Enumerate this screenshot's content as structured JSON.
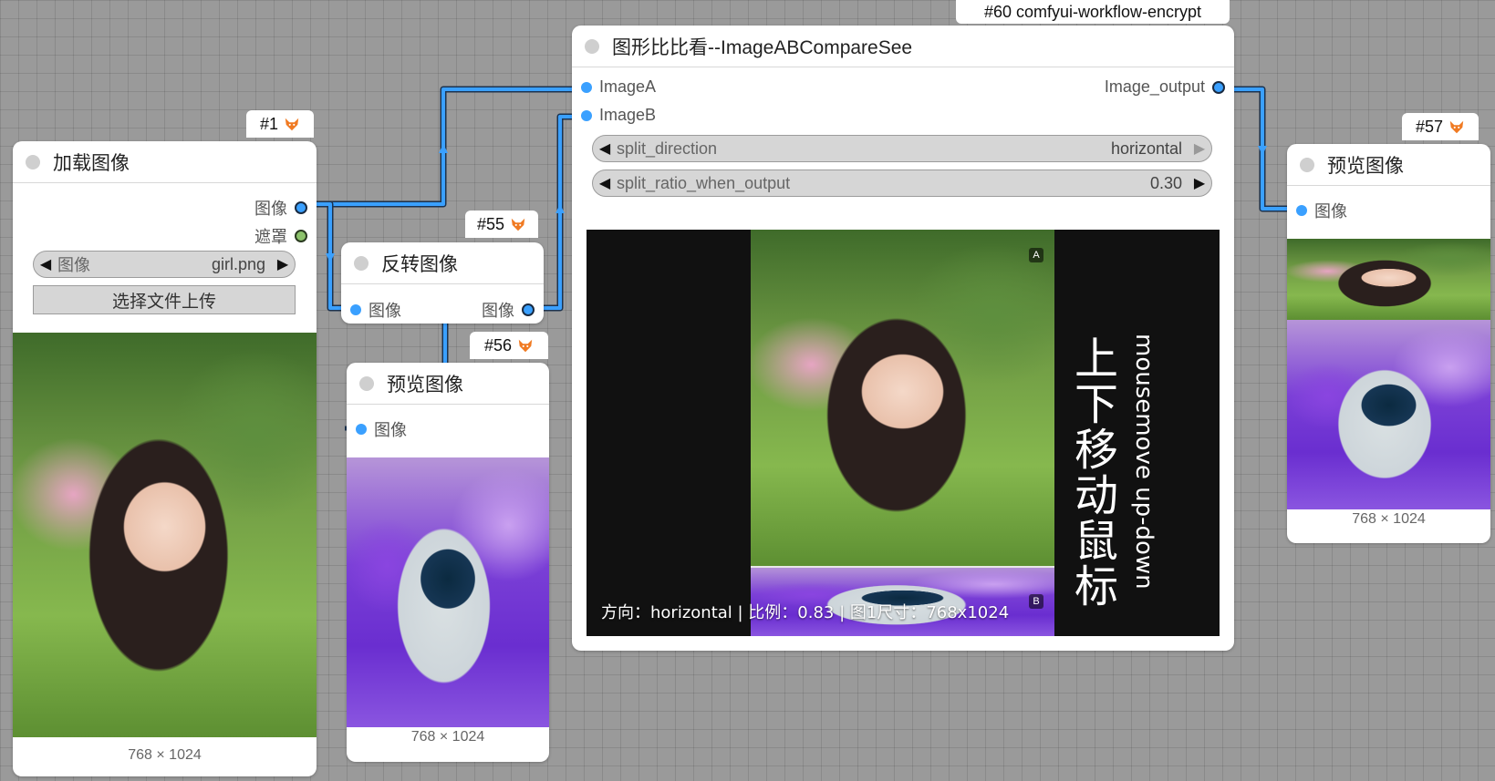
{
  "nodes": {
    "load_image": {
      "id_badge": "#1",
      "title": "加载图像",
      "outputs": [
        "图像",
        "遮罩"
      ],
      "image_widget": {
        "label": "图像",
        "value": "girl.png"
      },
      "upload_button": "选择文件上传",
      "image_size": "768 × 1024"
    },
    "invert_image": {
      "id_badge": "#55",
      "title": "反转图像",
      "input": "图像",
      "output": "图像"
    },
    "preview_56": {
      "id_badge": "#56",
      "title": "预览图像",
      "input": "图像",
      "image_size": "768 × 1024"
    },
    "compare": {
      "id_badge": "#60 comfyui-workflow-encrypt",
      "title": "图形比比看--ImageABCompareSee",
      "inputs": [
        "ImageA",
        "ImageB"
      ],
      "output": "Image_output",
      "split_direction": {
        "label": "split_direction",
        "value": "horizontal"
      },
      "split_ratio": {
        "label": "split_ratio_when_output",
        "value": "0.30"
      },
      "marker_a": "A",
      "marker_b": "B",
      "hint_cn": "上下移动鼠标",
      "hint_en": "mousemove up-down",
      "status_line": "方向：horizontal | 比例：0.83 | 图1尺寸：768x1024",
      "split_position": 0.83
    },
    "preview_57": {
      "id_badge": "#57",
      "title": "预览图像",
      "input": "图像",
      "image_size": "768 × 1024"
    }
  },
  "colors": {
    "canvas": "#9a9a9a",
    "link": "#3aa0ff",
    "pin_image": "#3aa0ff",
    "pin_mask": "#8cc26b"
  }
}
